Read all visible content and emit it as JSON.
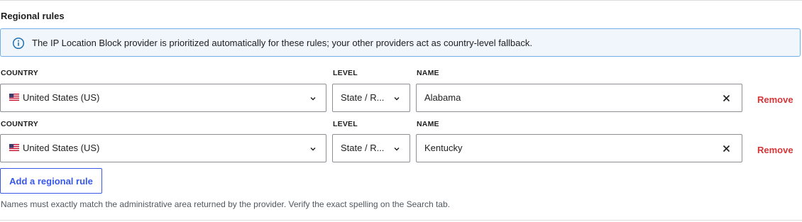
{
  "section": {
    "title": "Regional rules"
  },
  "notice": {
    "icon": "info-icon",
    "text": "The IP Location Block provider is prioritized automatically for these rules; your other providers act as country-level fallback."
  },
  "labels": {
    "country": "COUNTRY",
    "level": "LEVEL",
    "name": "NAME"
  },
  "rules": [
    {
      "country": "United States (US)",
      "country_flag": "us-flag-icon",
      "level": "State / R...",
      "name": "Alabama",
      "remove_label": "Remove"
    },
    {
      "country": "United States (US)",
      "country_flag": "us-flag-icon",
      "level": "State / R...",
      "name": "Kentucky",
      "remove_label": "Remove"
    }
  ],
  "add_button_label": "Add a regional rule",
  "help_text": "Names must exactly match the administrative area returned by the provider. Verify the exact spelling on the Search tab.",
  "colors": {
    "accent": "#3858e9",
    "danger": "#d63638",
    "notice_bg": "#f0f6fc",
    "notice_border": "#72aee6"
  }
}
